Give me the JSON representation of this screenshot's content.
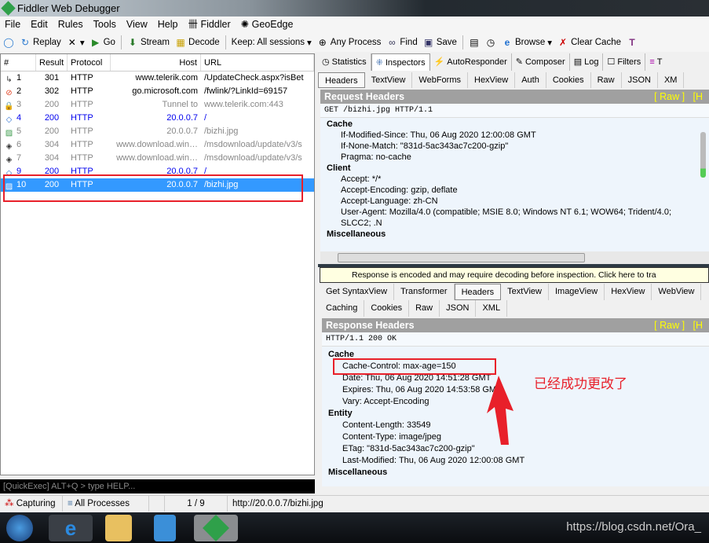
{
  "window": {
    "title": "Fiddler Web Debugger"
  },
  "menu": [
    "File",
    "Edit",
    "Rules",
    "Tools",
    "View",
    "Help",
    "Fiddler",
    "GeoEdge"
  ],
  "toolbar": {
    "replay": "Replay",
    "go": "Go",
    "stream": "Stream",
    "decode": "Decode",
    "keep": "Keep: All sessions",
    "process": "Any Process",
    "find": "Find",
    "save": "Save",
    "browse": "Browse",
    "clear_cache": "Clear Cache"
  },
  "sessions": {
    "columns": [
      "#",
      "Result",
      "Protocol",
      "Host",
      "URL"
    ],
    "rows": [
      {
        "id": "1",
        "result": "301",
        "protocol": "HTTP",
        "host": "www.telerik.com",
        "url": "/UpdateCheck.aspx?isBet",
        "color": "#000",
        "icon": "redirect-icon"
      },
      {
        "id": "2",
        "result": "302",
        "protocol": "HTTP",
        "host": "go.microsoft.com",
        "url": "/fwlink/?LinkId=69157",
        "color": "#000",
        "icon": "blocked-icon"
      },
      {
        "id": "3",
        "result": "200",
        "protocol": "HTTP",
        "host": "Tunnel to",
        "url": "www.telerik.com:443",
        "color": "#888",
        "icon": "lock-icon"
      },
      {
        "id": "4",
        "result": "200",
        "protocol": "HTTP",
        "host": "20.0.0.7",
        "url": "/",
        "color": "#0000ee",
        "icon": "html-icon"
      },
      {
        "id": "5",
        "result": "200",
        "protocol": "HTTP",
        "host": "20.0.0.7",
        "url": "/bizhi.jpg",
        "color": "#888",
        "icon": "image-icon"
      },
      {
        "id": "6",
        "result": "304",
        "protocol": "HTTP",
        "host": "www.download.win…",
        "url": "/msdownload/update/v3/s",
        "color": "#888",
        "icon": "cabinet-icon"
      },
      {
        "id": "7",
        "result": "304",
        "protocol": "HTTP",
        "host": "www.download.win…",
        "url": "/msdownload/update/v3/s",
        "color": "#888",
        "icon": "cabinet-icon"
      },
      {
        "id": "9",
        "result": "200",
        "protocol": "HTTP",
        "host": "20.0.0.7",
        "url": "/",
        "color": "#0000ee",
        "icon": "html-icon"
      },
      {
        "id": "10",
        "result": "200",
        "protocol": "HTTP",
        "host": "20.0.0.7",
        "url": "/bizhi.jpg",
        "color": "#fff",
        "icon": "image-icon",
        "selected": true
      }
    ]
  },
  "quickexec": {
    "placeholder": "[QuickExec] ALT+Q > type HELP..."
  },
  "status": {
    "capturing": "Capturing",
    "processes": "All Processes",
    "count": "1 / 9",
    "url": "http://20.0.0.7/bizhi.jpg"
  },
  "main_tabs": [
    "Statistics",
    "Inspectors",
    "AutoResponder",
    "Composer",
    "Log",
    "Filters",
    "T"
  ],
  "request": {
    "tabs": [
      "Headers",
      "TextView",
      "WebForms",
      "HexView",
      "Auth",
      "Cookies",
      "Raw",
      "JSON",
      "XM"
    ],
    "title": "Request Headers",
    "raw_link": "[ Raw ]",
    "header_link": "[H",
    "line": "GET /bizhi.jpg HTTP/1.1",
    "groups": [
      {
        "name": "Cache",
        "headers": [
          "If-Modified-Since: Thu, 06 Aug 2020 12:00:08 GMT",
          "If-None-Match: \"831d-5ac343ac7c200-gzip\"",
          "Pragma: no-cache"
        ]
      },
      {
        "name": "Client",
        "headers": [
          "Accept: */*",
          "Accept-Encoding: gzip, deflate",
          "Accept-Language: zh-CN",
          "User-Agent: Mozilla/4.0 (compatible; MSIE 8.0; Windows NT 6.1; WOW64; Trident/4.0; SLCC2; .N"
        ]
      },
      {
        "name": "Miscellaneous",
        "headers": []
      }
    ]
  },
  "banner": "Response is encoded and may require decoding before inspection. Click here to tra",
  "response": {
    "tabs_row1": [
      "Get SyntaxView",
      "Transformer",
      "Headers",
      "TextView",
      "ImageView",
      "HexView",
      "WebView"
    ],
    "tabs_row2": [
      "Caching",
      "Cookies",
      "Raw",
      "JSON",
      "XML"
    ],
    "title": "Response Headers",
    "raw_link": "[ Raw ]",
    "header_link": "[H",
    "line": "HTTP/1.1 200 OK",
    "groups": [
      {
        "name": "Cache",
        "headers": [
          "Cache-Control: max-age=150",
          "Date: Thu, 06 Aug 2020 14:51:28 GMT",
          "Expires: Thu, 06 Aug 2020 14:53:58 GMT",
          "Vary: Accept-Encoding"
        ]
      },
      {
        "name": "Entity",
        "headers": [
          "Content-Length: 33549",
          "Content-Type: image/jpeg",
          "ETag: \"831d-5ac343ac7c200-gzip\"",
          "Last-Modified: Thu, 06 Aug 2020 12:00:08 GMT"
        ]
      },
      {
        "name": "Miscellaneous",
        "headers": []
      }
    ]
  },
  "annotation": "已经成功更改了",
  "watermark": "https://blog.csdn.net/Ora_",
  "colors": {
    "selection": "#3399ff",
    "highlight": "#e8202a",
    "section_title": "#a0a0a0"
  }
}
